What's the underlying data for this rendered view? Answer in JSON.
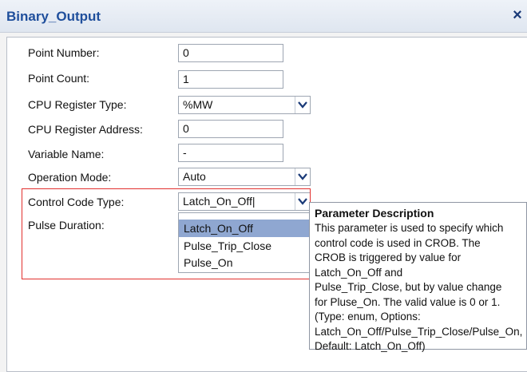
{
  "window": {
    "title": "Binary_Output",
    "close_glyph": "×",
    "close_icon": "close-icon"
  },
  "form": {
    "point_number": {
      "label": "Point Number:",
      "value": "0"
    },
    "point_count": {
      "label": "Point Count:",
      "value": "1"
    },
    "cpu_register_type": {
      "label": "CPU Register Type:",
      "value": "%MW"
    },
    "cpu_register_address": {
      "label": "CPU Register Address:",
      "value": "0"
    },
    "variable_name": {
      "label": "Variable Name:",
      "value": "-"
    },
    "operation_mode": {
      "label": "Operation Mode:",
      "value": "Auto"
    },
    "control_code_type": {
      "label": "Control Code Type:",
      "value": "Latch_On_Off|"
    },
    "pulse_duration": {
      "label": "Pulse Duration:"
    }
  },
  "dropdown": {
    "options": [
      "Latch_On_Off",
      "Pulse_Trip_Close",
      "Pulse_On"
    ],
    "selected_index": 0
  },
  "tooltip": {
    "title": "Parameter Description",
    "body": "This parameter is used to specify which\ncontrol code is used in CROB. The\nCROB is triggered by value for\nLatch_On_Off and\nPulse_Trip_Close, but by value change\nfor Pluse_On. The valid value is 0 or 1.\n(Type: enum, Options:\nLatch_On_Off/Pulse_Trip_Close/Pulse_On,\nDefault: Latch_On_Off)"
  },
  "colors": {
    "title_text": "#1f4f9c",
    "highlight_border": "#e2302e",
    "selected_option_bg": "#8fa7d1"
  }
}
